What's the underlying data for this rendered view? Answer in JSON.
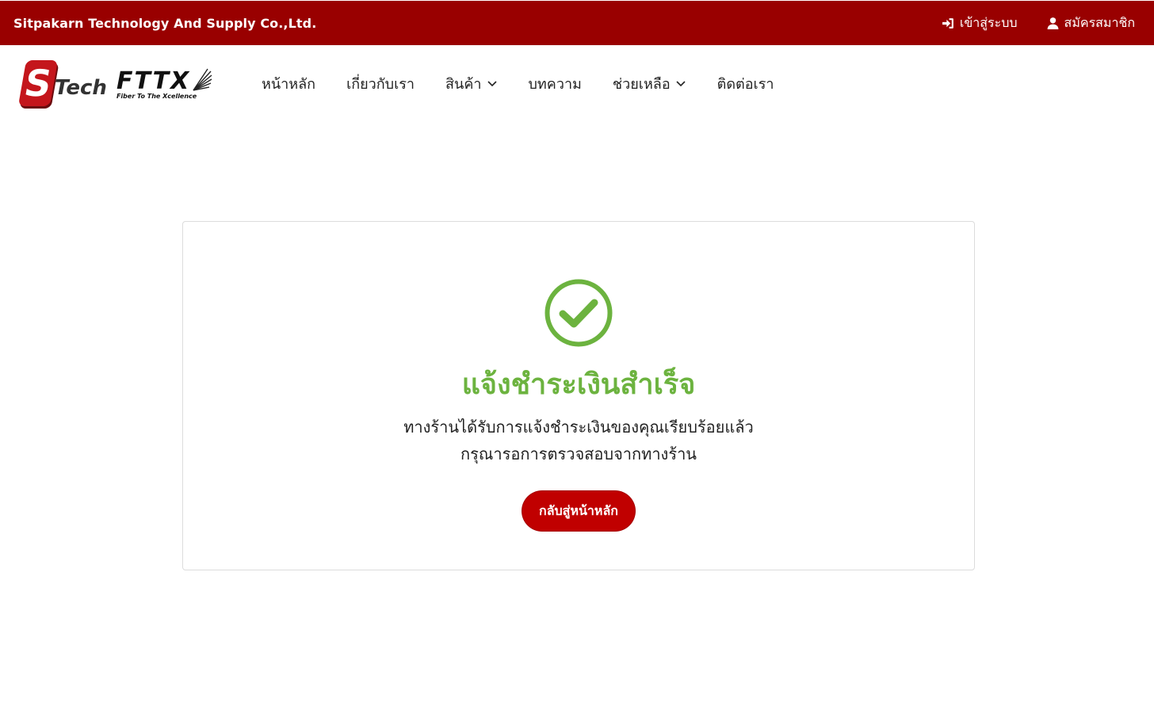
{
  "topbar": {
    "company_name": "Sitpakarn Technology And Supply Co.,Ltd.",
    "login_label": "เข้าสู่ระบบ",
    "login_icon": "sign-in-icon",
    "register_label": "สมัครสมาชิก",
    "register_icon": "user-icon",
    "background_color": "#990000"
  },
  "logo": {
    "brand_letter": "S",
    "brand_word": "Tech",
    "product_word": "FTTX",
    "product_tagline": "Fiber To The Xcellence"
  },
  "nav": {
    "items": [
      {
        "label": "หน้าหลัก",
        "has_dropdown": false
      },
      {
        "label": "เกี่ยวกับเรา",
        "has_dropdown": false
      },
      {
        "label": "สินค้า",
        "has_dropdown": true
      },
      {
        "label": "บทความ",
        "has_dropdown": false
      },
      {
        "label": "ช่วยเหลือ",
        "has_dropdown": true
      },
      {
        "label": "ติดต่อเรา",
        "has_dropdown": false
      }
    ]
  },
  "result": {
    "icon": "check-circle-icon",
    "title": "แจ้งชำระเงินสำเร็จ",
    "message_line1": "ทางร้านได้รับการแจ้งชำระเงินของคุณเรียบร้อยแล้ว",
    "message_line2": "กรุณารอการตรวจสอบจากทางร้าน",
    "button_label": "กลับสู่หน้าหลัก",
    "accent_color": "#6cb33f",
    "button_color": "#c00000"
  }
}
